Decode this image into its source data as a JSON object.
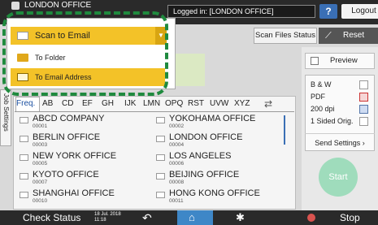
{
  "topbar": {
    "title": "LONDON OFFICE",
    "login_status": "Logged in: [LONDON OFFICE]",
    "help_label": "?",
    "logout_label": "Logout"
  },
  "toolbar": {
    "scan_files_status": "Scan Files Status",
    "reset_label": "Reset"
  },
  "dropdown": {
    "selected": "Scan to Email",
    "options": [
      {
        "label": "To Folder",
        "icon": "folder-icon"
      },
      {
        "label": "To Email Address",
        "icon": "envelope-icon"
      }
    ]
  },
  "job_settings_tab": "Job Settings",
  "address_tabs": [
    "Freq.",
    "AB",
    "CD",
    "EF",
    "GH",
    "IJK",
    "LMN",
    "OPQ",
    "RST",
    "UVW",
    "XYZ"
  ],
  "entries": [
    {
      "name": "ABCD COMPANY",
      "num": "00001"
    },
    {
      "name": "YOKOHAMA OFFICE",
      "num": "00002"
    },
    {
      "name": "BERLIN OFFICE",
      "num": "00003"
    },
    {
      "name": "LONDON OFFICE",
      "num": "00004"
    },
    {
      "name": "NEW YORK OFFICE",
      "num": "00005"
    },
    {
      "name": "LOS ANGELES",
      "num": "00006"
    },
    {
      "name": "KYOTO OFFICE",
      "num": "00007"
    },
    {
      "name": "BEIJING OFFICE",
      "num": "00008"
    },
    {
      "name": "SHANGHAI OFFICE",
      "num": "00010"
    },
    {
      "name": "HONG KONG OFFICE",
      "num": "00011"
    }
  ],
  "right_panel": {
    "preview": "Preview",
    "settings": [
      "B & W",
      "PDF",
      "200 dpi",
      "1 Sided Orig."
    ],
    "send_settings": "Send Settings",
    "start": "Start"
  },
  "bottombar": {
    "check_status": "Check Status",
    "date": "18 Jul. 2018",
    "time": "11:18",
    "stop": "Stop"
  },
  "colors": {
    "accent_yellow": "#f3c228",
    "home_blue": "#3e87c7",
    "start_green": "#9fdcbc",
    "highlight_dashed": "#1f8a3e"
  }
}
